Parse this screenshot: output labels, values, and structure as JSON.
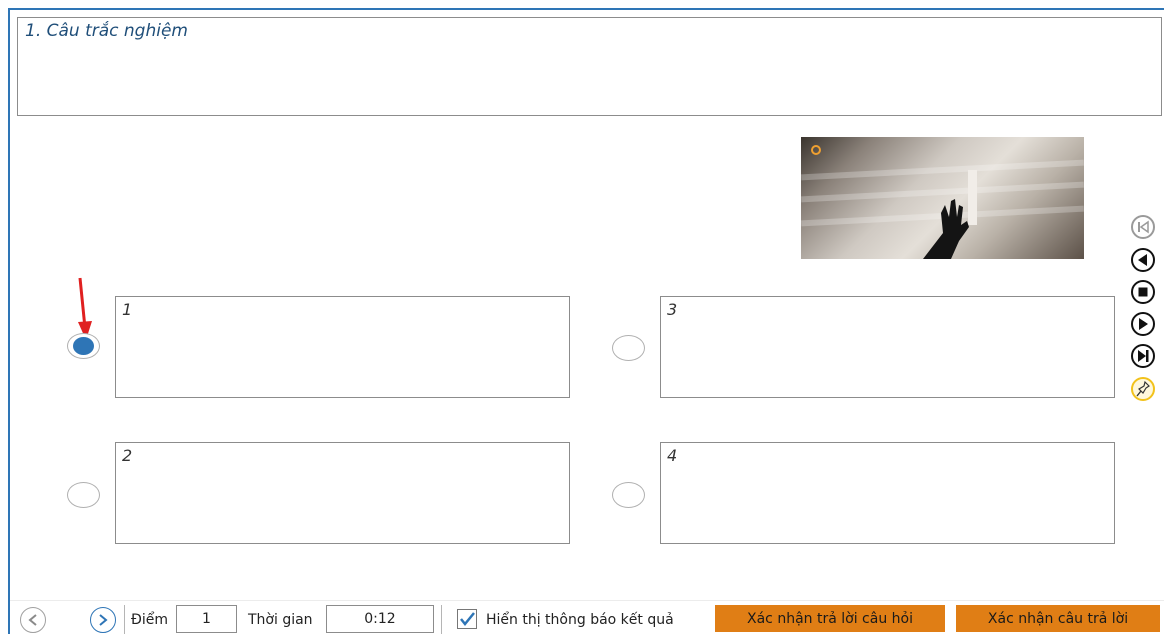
{
  "question": {
    "title": "1. Câu trắc nghiệm"
  },
  "answers": [
    {
      "label": "1",
      "selected": true
    },
    {
      "label": "2",
      "selected": false
    },
    {
      "label": "3",
      "selected": false
    },
    {
      "label": "4",
      "selected": false
    }
  ],
  "media_controls": [
    {
      "name": "skip-to-start-icon",
      "enabled": false
    },
    {
      "name": "rewind-icon",
      "enabled": true
    },
    {
      "name": "stop-icon",
      "enabled": true
    },
    {
      "name": "play-icon",
      "enabled": true
    },
    {
      "name": "skip-to-end-icon",
      "enabled": true
    },
    {
      "name": "pin-icon",
      "enabled": true
    }
  ],
  "toolbar": {
    "score_label": "Điểm",
    "score_value": "1",
    "time_label": "Thời gian",
    "time_value": "0:12",
    "show_result_label": "Hiển thị thông báo kết quả",
    "show_result_checked": true,
    "confirm_question_label": "Xác nhận trả lời câu hỏi",
    "confirm_answer_label": "Xác nhận câu trả lời"
  },
  "colors": {
    "accent": "#2e75b6",
    "action_button": "#e07e15",
    "pin_accent": "#f2c21b",
    "annotation_arrow": "#e02020"
  }
}
